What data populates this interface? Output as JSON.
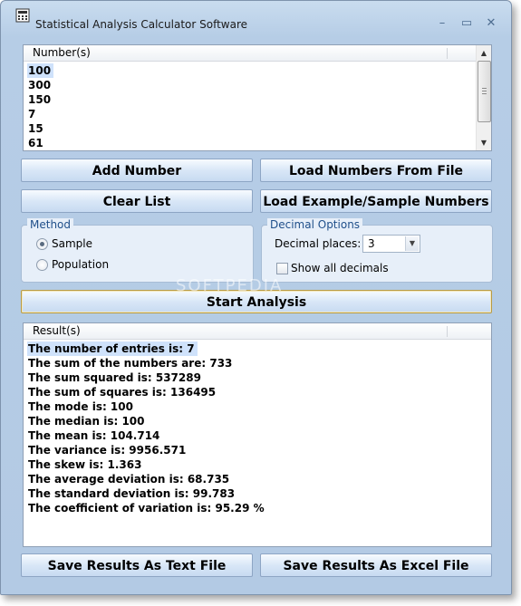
{
  "window": {
    "title": "Statistical Analysis Calculator Software",
    "minimize_glyph": "–",
    "maximize_glyph": "▭",
    "close_glyph": "✕"
  },
  "numbers_list": {
    "header": "Number(s)",
    "items": [
      "100",
      "300",
      "150",
      "7",
      "15",
      "61"
    ],
    "selected_index": 0
  },
  "buttons": {
    "add_number": "Add Number",
    "load_from_file": "Load Numbers From File",
    "clear_list": "Clear List",
    "load_example": "Load Example/Sample Numbers",
    "start_analysis": "Start Analysis",
    "save_text": "Save Results As Text File",
    "save_excel": "Save Results As Excel File"
  },
  "method": {
    "legend": "Method",
    "options": [
      "Sample",
      "Population"
    ],
    "selected": "Sample"
  },
  "decimal_options": {
    "legend": "Decimal Options",
    "places_label": "Decimal places:",
    "places_value": "3",
    "show_all_label": "Show all decimals",
    "show_all_checked": false
  },
  "results_list": {
    "header": "Result(s)",
    "items": [
      "The number of entries is: 7",
      "The sum of the numbers are: 733",
      "The sum squared is: 537289",
      "The sum of squares is: 136495",
      "The mode is: 100",
      "The median is: 100",
      "The mean is: 104.714",
      "The variance is: 9956.571",
      "The skew is: 1.363",
      "The average deviation is: 68.735",
      "The standard deviation is: 99.783",
      "The coefficient of variation is: 95.29 %"
    ],
    "selected_index": 0
  },
  "watermark": "SOFTPEDIA",
  "icons": {
    "app": "calculator-icon",
    "scroll_up": "scroll-up-arrow-icon",
    "scroll_down": "scroll-down-arrow-icon",
    "dropdown": "chevron-down-icon"
  },
  "colors": {
    "legend_text": "#1f4f8a",
    "selection": "#cfe2fb",
    "client_bg": "#ecf2fa"
  }
}
